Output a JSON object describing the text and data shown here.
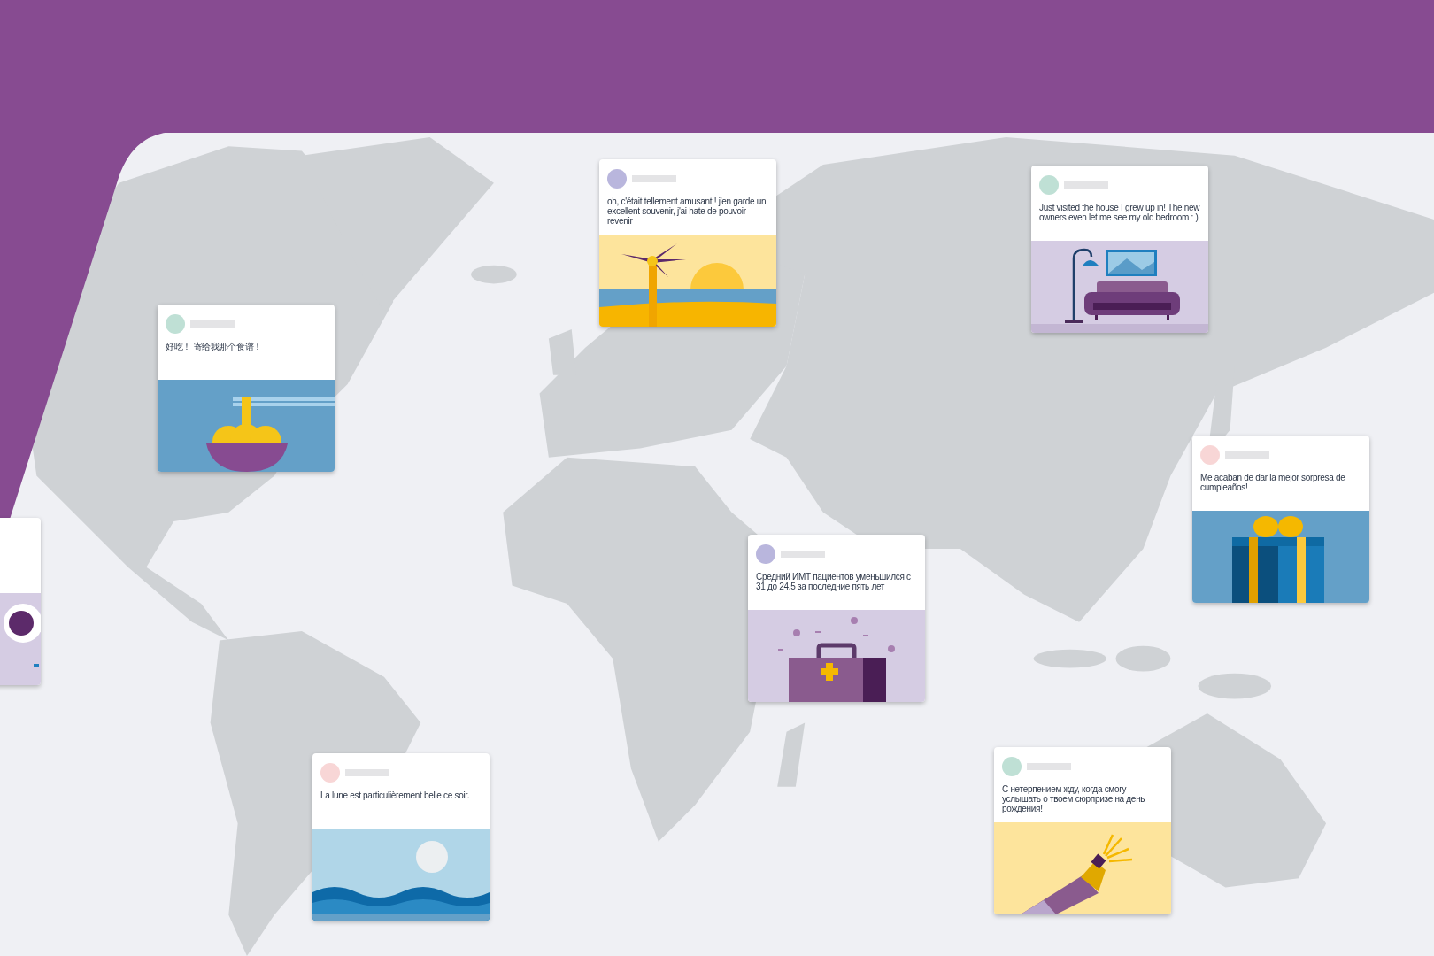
{
  "cards": [
    {
      "kind": "coffee"
    },
    {
      "color": "#bfe0d5",
      "text": "好吃！ 寄给我那个食谱！",
      "kind": "noodles"
    },
    {
      "color": "#b9b6dd",
      "text": "oh, c'était tellement amusant ! j'en garde un excellent souvenir, j'ai hate de pouvoir revenir",
      "kind": "beach"
    },
    {
      "color": "#bfe0d5",
      "text": "Just visited the house I grew up in! The new owners even let me see my old bedroom : )",
      "kind": "room"
    },
    {
      "color": "#f8d6d6",
      "text": "Me acaban de dar la mejor sorpresa de cumpleaños!",
      "kind": "gift"
    },
    {
      "color": "#b9b6dd",
      "text": "Средний ИМТ пациентов уменьшился с 31 до 24.5 за последние пять лет",
      "kind": "medical"
    },
    {
      "color": "#f8d6d6",
      "text": "La lune est particulièrement belle ce soir.",
      "kind": "moon"
    },
    {
      "color": "#bfe0d5",
      "text": "С нетерпением жду, когда смогу услышать о твоем сюрпризе на день рождения!",
      "kind": "champagne"
    }
  ]
}
